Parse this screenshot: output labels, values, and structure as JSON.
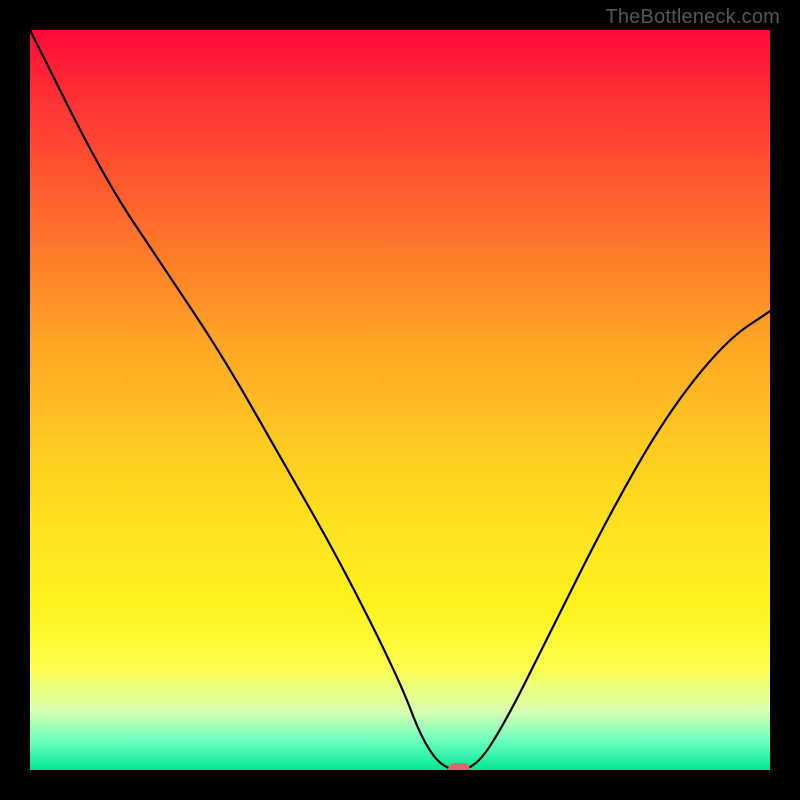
{
  "watermark": "TheBottleneck.com",
  "chart_data": {
    "type": "line",
    "title": "",
    "xlabel": "",
    "ylabel": "",
    "xlim": [
      0,
      100
    ],
    "ylim": [
      0,
      100
    ],
    "grid": false,
    "series": [
      {
        "name": "curve",
        "x": [
          0,
          10,
          18,
          26,
          34,
          42,
          50,
          53,
          56,
          60,
          64,
          70,
          78,
          86,
          94,
          100
        ],
        "y": [
          100,
          80,
          68,
          56,
          42,
          28,
          12,
          4,
          0,
          0,
          6,
          18,
          34,
          48,
          58,
          62
        ]
      }
    ],
    "marker": {
      "x": 58,
      "y": 0
    },
    "background_gradient": {
      "top": "#ff0a3a",
      "mid": "#ffe020",
      "bottom": "#00e892"
    }
  }
}
